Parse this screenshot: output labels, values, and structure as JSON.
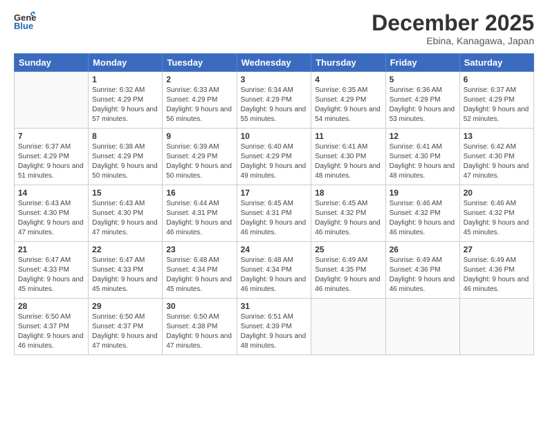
{
  "header": {
    "logo_line1": "General",
    "logo_line2": "Blue",
    "month": "December 2025",
    "location": "Ebina, Kanagawa, Japan"
  },
  "weekdays": [
    "Sunday",
    "Monday",
    "Tuesday",
    "Wednesday",
    "Thursday",
    "Friday",
    "Saturday"
  ],
  "weeks": [
    [
      {
        "day": "",
        "sunrise": "",
        "sunset": "",
        "daylight": ""
      },
      {
        "day": "1",
        "sunrise": "Sunrise: 6:32 AM",
        "sunset": "Sunset: 4:29 PM",
        "daylight": "Daylight: 9 hours and 57 minutes."
      },
      {
        "day": "2",
        "sunrise": "Sunrise: 6:33 AM",
        "sunset": "Sunset: 4:29 PM",
        "daylight": "Daylight: 9 hours and 56 minutes."
      },
      {
        "day": "3",
        "sunrise": "Sunrise: 6:34 AM",
        "sunset": "Sunset: 4:29 PM",
        "daylight": "Daylight: 9 hours and 55 minutes."
      },
      {
        "day": "4",
        "sunrise": "Sunrise: 6:35 AM",
        "sunset": "Sunset: 4:29 PM",
        "daylight": "Daylight: 9 hours and 54 minutes."
      },
      {
        "day": "5",
        "sunrise": "Sunrise: 6:36 AM",
        "sunset": "Sunset: 4:29 PM",
        "daylight": "Daylight: 9 hours and 53 minutes."
      },
      {
        "day": "6",
        "sunrise": "Sunrise: 6:37 AM",
        "sunset": "Sunset: 4:29 PM",
        "daylight": "Daylight: 9 hours and 52 minutes."
      }
    ],
    [
      {
        "day": "7",
        "sunrise": "Sunrise: 6:37 AM",
        "sunset": "Sunset: 4:29 PM",
        "daylight": "Daylight: 9 hours and 51 minutes."
      },
      {
        "day": "8",
        "sunrise": "Sunrise: 6:38 AM",
        "sunset": "Sunset: 4:29 PM",
        "daylight": "Daylight: 9 hours and 50 minutes."
      },
      {
        "day": "9",
        "sunrise": "Sunrise: 6:39 AM",
        "sunset": "Sunset: 4:29 PM",
        "daylight": "Daylight: 9 hours and 50 minutes."
      },
      {
        "day": "10",
        "sunrise": "Sunrise: 6:40 AM",
        "sunset": "Sunset: 4:29 PM",
        "daylight": "Daylight: 9 hours and 49 minutes."
      },
      {
        "day": "11",
        "sunrise": "Sunrise: 6:41 AM",
        "sunset": "Sunset: 4:30 PM",
        "daylight": "Daylight: 9 hours and 48 minutes."
      },
      {
        "day": "12",
        "sunrise": "Sunrise: 6:41 AM",
        "sunset": "Sunset: 4:30 PM",
        "daylight": "Daylight: 9 hours and 48 minutes."
      },
      {
        "day": "13",
        "sunrise": "Sunrise: 6:42 AM",
        "sunset": "Sunset: 4:30 PM",
        "daylight": "Daylight: 9 hours and 47 minutes."
      }
    ],
    [
      {
        "day": "14",
        "sunrise": "Sunrise: 6:43 AM",
        "sunset": "Sunset: 4:30 PM",
        "daylight": "Daylight: 9 hours and 47 minutes."
      },
      {
        "day": "15",
        "sunrise": "Sunrise: 6:43 AM",
        "sunset": "Sunset: 4:30 PM",
        "daylight": "Daylight: 9 hours and 47 minutes."
      },
      {
        "day": "16",
        "sunrise": "Sunrise: 6:44 AM",
        "sunset": "Sunset: 4:31 PM",
        "daylight": "Daylight: 9 hours and 46 minutes."
      },
      {
        "day": "17",
        "sunrise": "Sunrise: 6:45 AM",
        "sunset": "Sunset: 4:31 PM",
        "daylight": "Daylight: 9 hours and 46 minutes."
      },
      {
        "day": "18",
        "sunrise": "Sunrise: 6:45 AM",
        "sunset": "Sunset: 4:32 PM",
        "daylight": "Daylight: 9 hours and 46 minutes."
      },
      {
        "day": "19",
        "sunrise": "Sunrise: 6:46 AM",
        "sunset": "Sunset: 4:32 PM",
        "daylight": "Daylight: 9 hours and 46 minutes."
      },
      {
        "day": "20",
        "sunrise": "Sunrise: 6:46 AM",
        "sunset": "Sunset: 4:32 PM",
        "daylight": "Daylight: 9 hours and 45 minutes."
      }
    ],
    [
      {
        "day": "21",
        "sunrise": "Sunrise: 6:47 AM",
        "sunset": "Sunset: 4:33 PM",
        "daylight": "Daylight: 9 hours and 45 minutes."
      },
      {
        "day": "22",
        "sunrise": "Sunrise: 6:47 AM",
        "sunset": "Sunset: 4:33 PM",
        "daylight": "Daylight: 9 hours and 45 minutes."
      },
      {
        "day": "23",
        "sunrise": "Sunrise: 6:48 AM",
        "sunset": "Sunset: 4:34 PM",
        "daylight": "Daylight: 9 hours and 45 minutes."
      },
      {
        "day": "24",
        "sunrise": "Sunrise: 6:48 AM",
        "sunset": "Sunset: 4:34 PM",
        "daylight": "Daylight: 9 hours and 46 minutes."
      },
      {
        "day": "25",
        "sunrise": "Sunrise: 6:49 AM",
        "sunset": "Sunset: 4:35 PM",
        "daylight": "Daylight: 9 hours and 46 minutes."
      },
      {
        "day": "26",
        "sunrise": "Sunrise: 6:49 AM",
        "sunset": "Sunset: 4:36 PM",
        "daylight": "Daylight: 9 hours and 46 minutes."
      },
      {
        "day": "27",
        "sunrise": "Sunrise: 6:49 AM",
        "sunset": "Sunset: 4:36 PM",
        "daylight": "Daylight: 9 hours and 46 minutes."
      }
    ],
    [
      {
        "day": "28",
        "sunrise": "Sunrise: 6:50 AM",
        "sunset": "Sunset: 4:37 PM",
        "daylight": "Daylight: 9 hours and 46 minutes."
      },
      {
        "day": "29",
        "sunrise": "Sunrise: 6:50 AM",
        "sunset": "Sunset: 4:37 PM",
        "daylight": "Daylight: 9 hours and 47 minutes."
      },
      {
        "day": "30",
        "sunrise": "Sunrise: 6:50 AM",
        "sunset": "Sunset: 4:38 PM",
        "daylight": "Daylight: 9 hours and 47 minutes."
      },
      {
        "day": "31",
        "sunrise": "Sunrise: 6:51 AM",
        "sunset": "Sunset: 4:39 PM",
        "daylight": "Daylight: 9 hours and 48 minutes."
      },
      {
        "day": "",
        "sunrise": "",
        "sunset": "",
        "daylight": ""
      },
      {
        "day": "",
        "sunrise": "",
        "sunset": "",
        "daylight": ""
      },
      {
        "day": "",
        "sunrise": "",
        "sunset": "",
        "daylight": ""
      }
    ]
  ]
}
